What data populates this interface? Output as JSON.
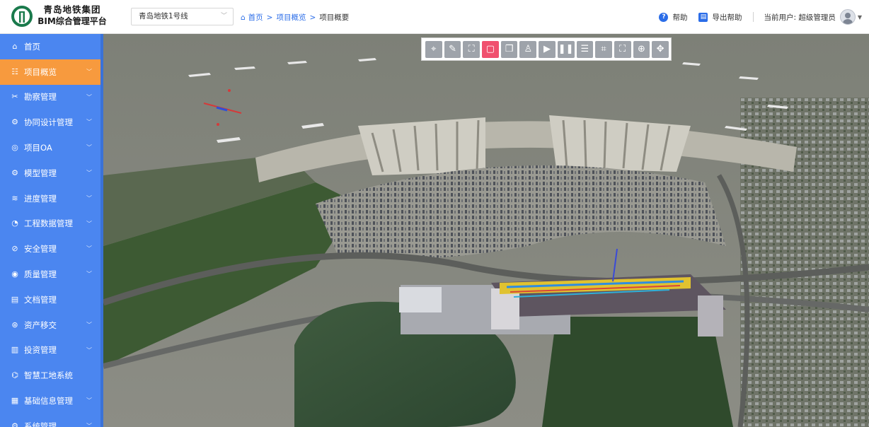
{
  "brand": {
    "line1": "青岛地铁集团",
    "line2": "BIM综合管理平台",
    "color": "#1a7a4c"
  },
  "header": {
    "line_select": {
      "value": "青岛地铁1号线"
    },
    "breadcrumb": [
      "首页",
      "项目概览",
      "项目概要"
    ],
    "help_label": "帮助",
    "export_help_label": "导出帮助",
    "current_user": "当前用户: 超级管理员"
  },
  "sidebar": {
    "items": [
      {
        "label": "首页",
        "icon": "home-icon",
        "has_caret": false,
        "active": false
      },
      {
        "label": "项目概览",
        "icon": "overview-icon",
        "has_caret": true,
        "active": true
      },
      {
        "label": "勘察管理",
        "icon": "survey-icon",
        "has_caret": true,
        "active": false
      },
      {
        "label": "协同设计管理",
        "icon": "collab-icon",
        "has_caret": true,
        "active": false
      },
      {
        "label": "项目OA",
        "icon": "oa-icon",
        "has_caret": true,
        "active": false
      },
      {
        "label": "模型管理",
        "icon": "model-icon",
        "has_caret": true,
        "active": false
      },
      {
        "label": "进度管理",
        "icon": "progress-icon",
        "has_caret": true,
        "active": false
      },
      {
        "label": "工程数据管理",
        "icon": "pie-chart-icon",
        "has_caret": true,
        "active": false
      },
      {
        "label": "安全管理",
        "icon": "shield-icon",
        "has_caret": true,
        "active": false
      },
      {
        "label": "质量管理",
        "icon": "quality-icon",
        "has_caret": true,
        "active": false
      },
      {
        "label": "文档管理",
        "icon": "document-icon",
        "has_caret": false,
        "active": false
      },
      {
        "label": "资产移交",
        "icon": "asset-icon",
        "has_caret": true,
        "active": false
      },
      {
        "label": "投资管理",
        "icon": "investment-icon",
        "has_caret": true,
        "active": false
      },
      {
        "label": "智慧工地系统",
        "icon": "site-icon",
        "has_caret": false,
        "active": false
      },
      {
        "label": "基础信息管理",
        "icon": "info-icon",
        "has_caret": true,
        "active": false
      },
      {
        "label": "系统管理",
        "icon": "settings-icon",
        "has_caret": true,
        "active": false
      }
    ]
  },
  "toolbar": {
    "buttons": [
      {
        "name": "location-pin-icon",
        "active": false
      },
      {
        "name": "measure-ruler-icon",
        "active": false
      },
      {
        "name": "focus-frame-icon",
        "active": false
      },
      {
        "name": "selection-box-icon",
        "active": true
      },
      {
        "name": "cube-view-icon",
        "active": false
      },
      {
        "name": "roaming-person-icon",
        "active": false
      },
      {
        "name": "play-icon",
        "active": false
      },
      {
        "name": "pause-icon",
        "active": false
      },
      {
        "name": "layers-icon",
        "active": false
      },
      {
        "name": "crop-icon",
        "active": false
      },
      {
        "name": "fullscreen-frame-icon",
        "active": false
      },
      {
        "name": "crosshair-icon",
        "active": false
      },
      {
        "name": "expand-arrows-icon",
        "active": false
      }
    ]
  },
  "colors": {
    "sidebar_bg": "#4b86f0",
    "sidebar_active": "#f79a3e",
    "link_blue": "#2b6de8",
    "toolbar_active": "#f0506e"
  }
}
